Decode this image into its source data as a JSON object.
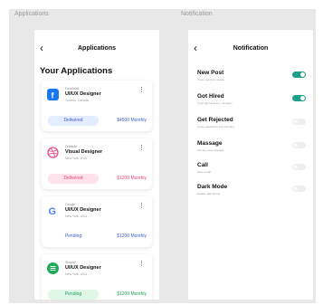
{
  "labels": {
    "applications_frame": "Applications",
    "notification_frame": "Notification"
  },
  "applications": {
    "header_title": "Applications",
    "section_title": "Your Applications",
    "cards": [
      {
        "company": "Facebook",
        "job": "UI/UX Designer",
        "location": "Toronto, Canada",
        "status": "Delivered",
        "salary": "$4500 Monthly",
        "logo": "facebook-icon"
      },
      {
        "company": "Dribbble",
        "job": "Visual Designer",
        "location": "New York, USA",
        "status": "Delivered",
        "salary": "$1200 Monthly",
        "logo": "dribbble-icon"
      },
      {
        "company": "Google",
        "job": "UI/UX Designer",
        "location": "New York, USA",
        "status": "Pending",
        "salary": "$1200 Monthly",
        "logo": "google-icon"
      },
      {
        "company": "Shopify",
        "job": "UI/UX Designer",
        "location": "New York, USA",
        "status": "Pending",
        "salary": "$1200 Monthly",
        "logo": "shopify-icon"
      }
    ]
  },
  "notification": {
    "header_title": "Notification",
    "rows": [
      {
        "title": "New Post",
        "subtitle": "If you new post update",
        "on": true
      },
      {
        "title": "Got Hired",
        "subtitle": "If you get hired any company",
        "on": true
      },
      {
        "title": "Get Rejected",
        "subtitle": "If you rejected by any company",
        "on": false
      },
      {
        "title": "Massage",
        "subtitle": "Get any new massage",
        "on": false
      },
      {
        "title": "Call",
        "subtitle": "Have a call",
        "on": false
      },
      {
        "title": "Dark Mode",
        "subtitle": "Enable dark theme",
        "on": false
      }
    ]
  },
  "colors": {
    "accent": "#1f9e8a",
    "facebook": "#1877f2",
    "dribbble": "#ea4c89",
    "shopify": "#1faa5a",
    "delivered_bg": "#e4ecff",
    "delivered_text": "#3d5cc7",
    "rejected_bg": "#ffe2ec",
    "rejected_text": "#e0457a",
    "pending_bg": "#e0f7e8",
    "pending_text": "#1e9e55",
    "salary_blue": "#3d5cc7",
    "salary_pink": "#e0457a",
    "salary_green": "#1e9e55"
  }
}
